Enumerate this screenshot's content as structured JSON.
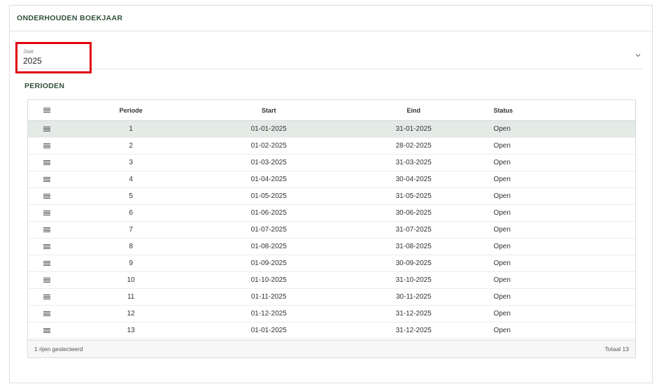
{
  "page": {
    "title": "ONDERHOUDEN BOEKJAAR"
  },
  "year_field": {
    "label": "Jaar",
    "value": "2025"
  },
  "section": {
    "title": "PERIODEN"
  },
  "table": {
    "columns": [
      "Periode",
      "Start",
      "Eind",
      "Status"
    ],
    "rows": [
      {
        "periode": "1",
        "start": "01-01-2025",
        "eind": "31-01-2025",
        "status": "Open"
      },
      {
        "periode": "2",
        "start": "01-02-2025",
        "eind": "28-02-2025",
        "status": "Open"
      },
      {
        "periode": "3",
        "start": "01-03-2025",
        "eind": "31-03-2025",
        "status": "Open"
      },
      {
        "periode": "4",
        "start": "01-04-2025",
        "eind": "30-04-2025",
        "status": "Open"
      },
      {
        "periode": "5",
        "start": "01-05-2025",
        "eind": "31-05-2025",
        "status": "Open"
      },
      {
        "periode": "6",
        "start": "01-06-2025",
        "eind": "30-06-2025",
        "status": "Open"
      },
      {
        "periode": "7",
        "start": "01-07-2025",
        "eind": "31-07-2025",
        "status": "Open"
      },
      {
        "periode": "8",
        "start": "01-08-2025",
        "eind": "31-08-2025",
        "status": "Open"
      },
      {
        "periode": "9",
        "start": "01-09-2025",
        "eind": "30-09-2025",
        "status": "Open"
      },
      {
        "periode": "10",
        "start": "01-10-2025",
        "eind": "31-10-2025",
        "status": "Open"
      },
      {
        "periode": "11",
        "start": "01-11-2025",
        "eind": "30-11-2025",
        "status": "Open"
      },
      {
        "periode": "12",
        "start": "01-12-2025",
        "eind": "31-12-2025",
        "status": "Open"
      },
      {
        "periode": "13",
        "start": "01-01-2025",
        "eind": "31-12-2025",
        "status": "Open"
      }
    ],
    "footer": {
      "selected_text": "1 rijen geslecteerd",
      "total_text": "Totaal 13"
    }
  },
  "colors": {
    "accent": "#2f4f3a",
    "highlight": "#e0000f",
    "selected_row": "#e4ebe7"
  },
  "icons": {
    "row_menu": "menu-lines-icon",
    "dropdown": "chevron-down-icon"
  }
}
